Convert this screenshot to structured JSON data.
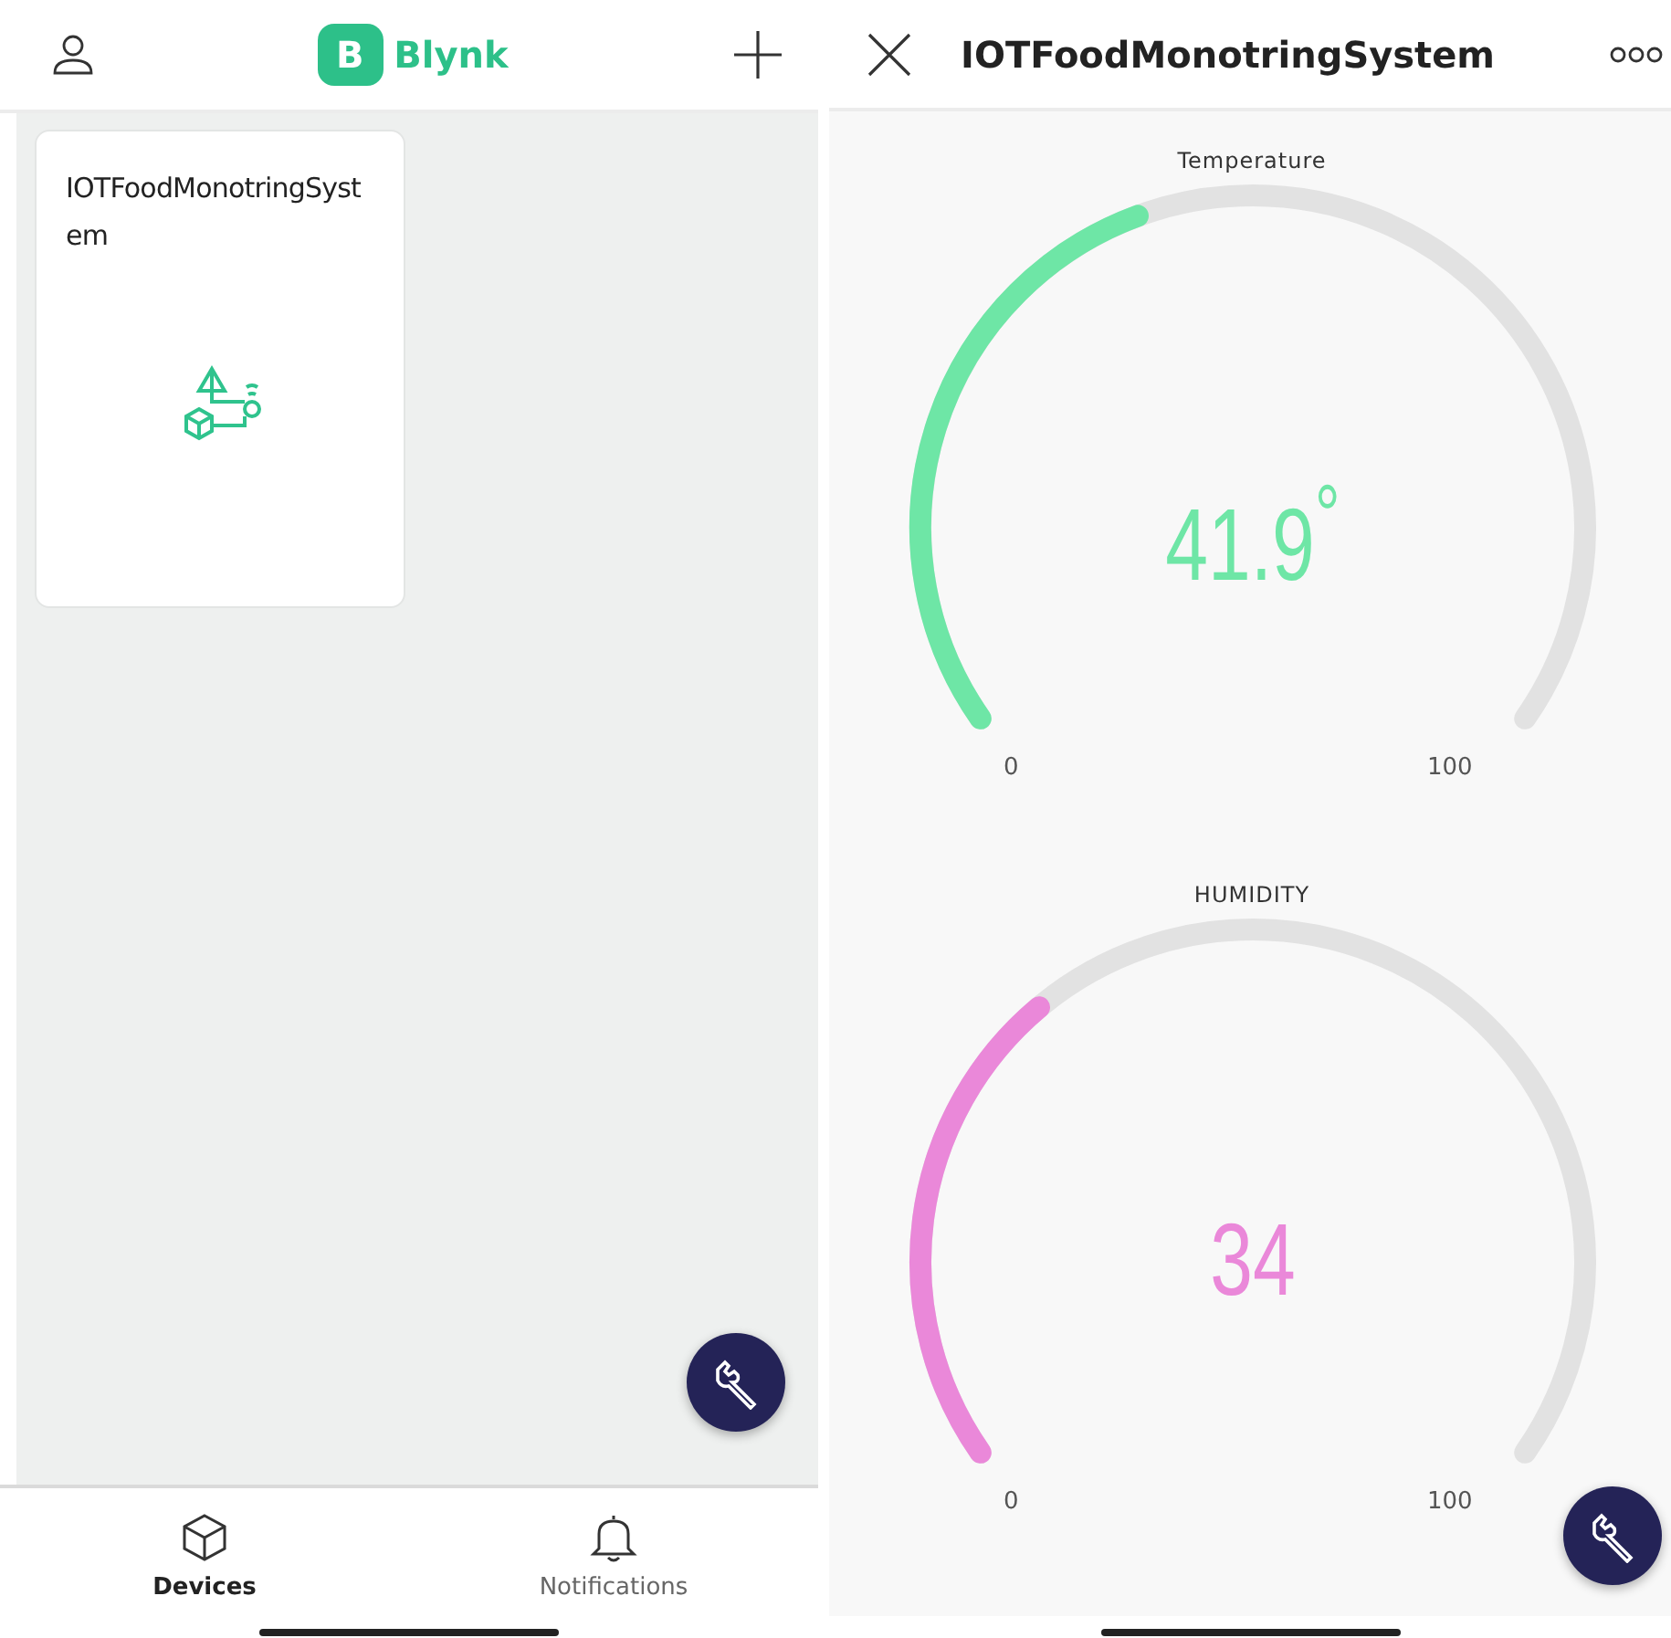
{
  "devices_screen": {
    "logo": {
      "letter": "B",
      "name": "Blynk"
    },
    "devices": [
      {
        "name": "IOTFoodMonotringSystem"
      }
    ],
    "tabs": [
      {
        "label": "Devices",
        "selected": true
      },
      {
        "label": "Notifications",
        "selected": false
      }
    ]
  },
  "dashboard_screen": {
    "title": "IOTFoodMonotringSystem",
    "gauges": [
      {
        "title": "Temperature",
        "value": "41.9$^{°}$",
        "min": "0",
        "max": "100",
        "color": "#6ee6a6"
      },
      {
        "title": "HUMIDITY",
        "value": "34",
        "min": "0",
        "max": "100",
        "color": "#ea88d9"
      }
    ]
  }
}
